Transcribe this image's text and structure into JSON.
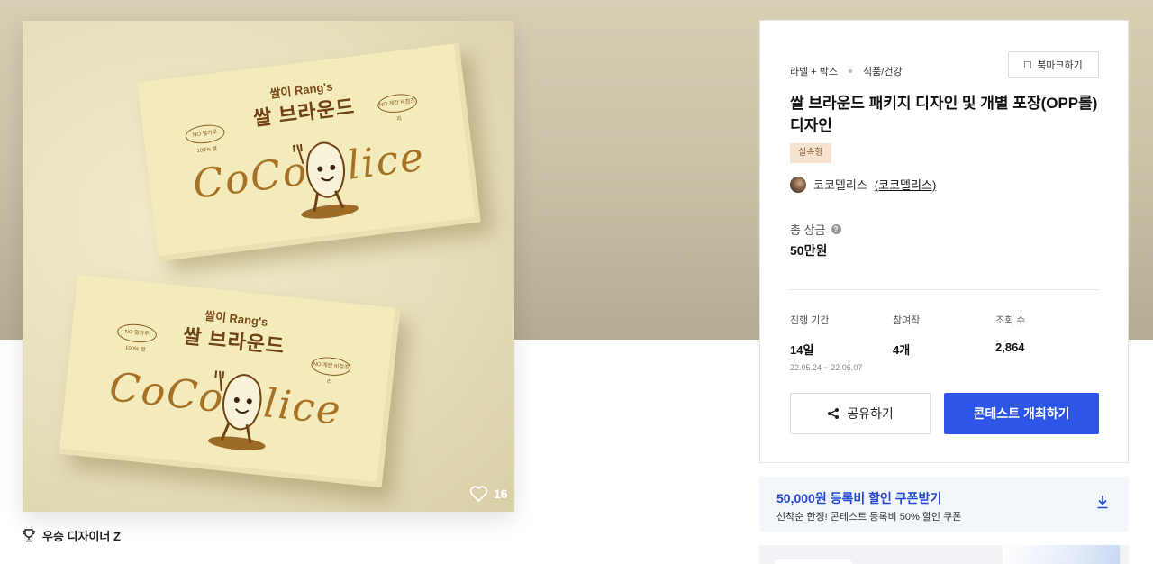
{
  "image": {
    "box_subtitle": "쌀이 Rang's",
    "box_title": "쌀 브라운드",
    "box_script": "CoCo  elice",
    "badge_left": "NO 밀가루 100% 쌀",
    "badge_right": "NO 계란 비첨조리",
    "like_count": "16"
  },
  "award": {
    "label": "우승 디자이너 Z"
  },
  "panel": {
    "category_1": "라벨 + 박스",
    "category_2": "식품/건강",
    "bookmark_label": "북마크하기",
    "title": "쌀 브라운드 패키지 디자인 및 개별 포장(OPP롤) 디자인",
    "tag": "실속형",
    "host_name": "코코델리스",
    "host_link": "(코코델리스)",
    "prize_label": "총 상금",
    "prize_help": "?",
    "prize_value": "50만원",
    "stats": [
      {
        "label": "진행 기간",
        "value": "14일",
        "sub": "22.05.24  ~  22.06.07"
      },
      {
        "label": "참여작",
        "value": "4개"
      },
      {
        "label": "조회 수",
        "value": "2,864"
      }
    ],
    "share_label": "공유하기",
    "host_button_label": "콘테스트 개최하기"
  },
  "coupon": {
    "title": "50,000원 등록비 할인 쿠폰받기",
    "subtitle": "선착순 한정! 콘테스트 등록비 50% 할인 쿠폰"
  },
  "colors": {
    "primary": "#2d55e6",
    "coupon_text": "#2348d2",
    "tag_bg": "#f3e3cf"
  }
}
